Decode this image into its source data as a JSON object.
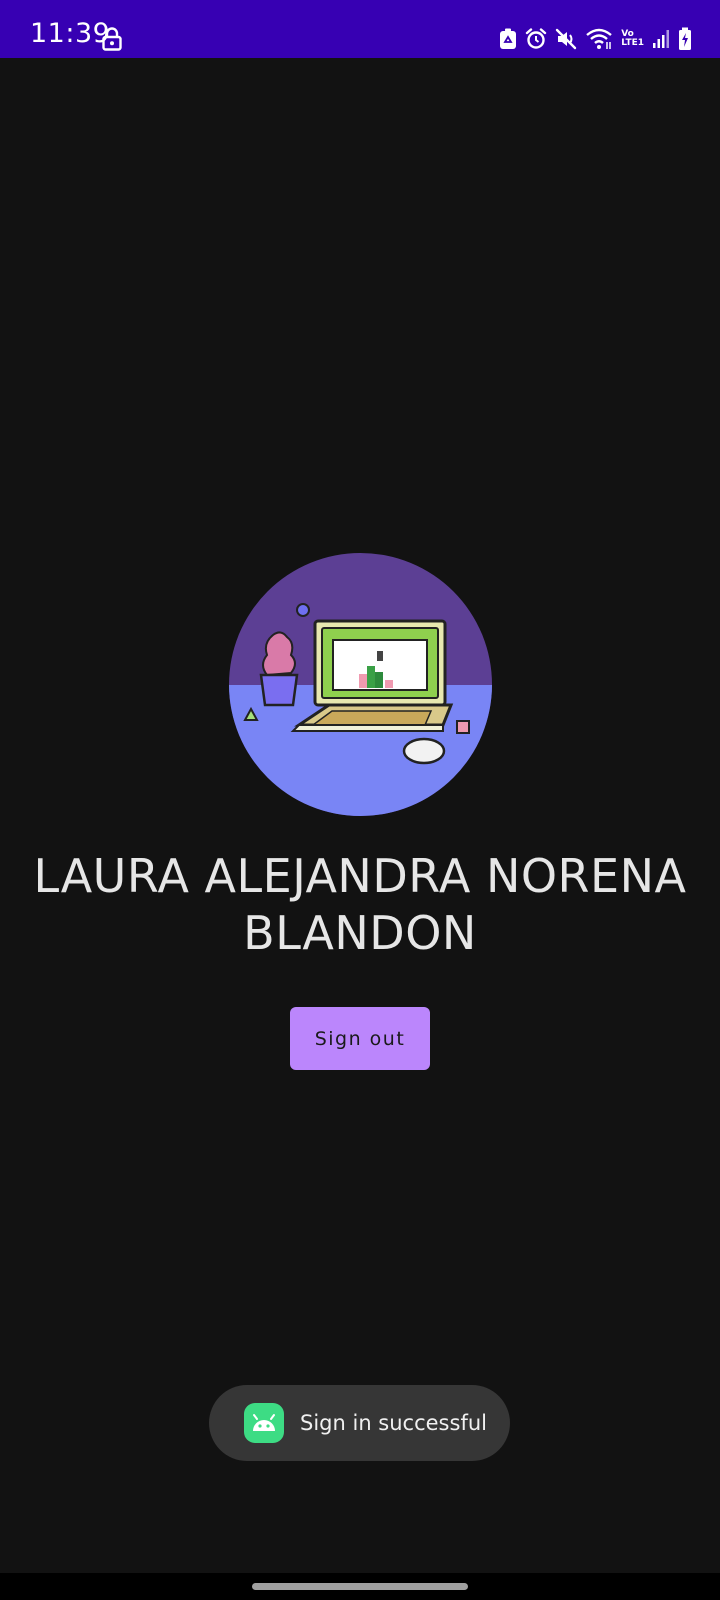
{
  "status_bar": {
    "time": "11:39",
    "background_color": "#3700b3",
    "icons": [
      "lock-icon",
      "recycle-icon",
      "alarm-icon",
      "mute-icon",
      "wifi-icon",
      "volte-lte-icon",
      "signal-icon",
      "battery-charging-icon"
    ],
    "network_label_top": "Vo",
    "network_label_bottom": "LTE1"
  },
  "profile": {
    "avatar_icon": "laptop-illustration",
    "name": "LAURA ALEJANDRA NORENA BLANDON"
  },
  "actions": {
    "sign_out_label": "Sign out",
    "accent_color": "#bb86fc"
  },
  "toast": {
    "icon": "android-app-icon",
    "message": "Sign in successful"
  },
  "navigation": {
    "handle_icon": "gesture-handle"
  }
}
